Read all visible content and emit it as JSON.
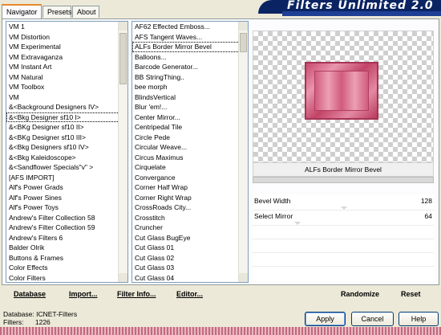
{
  "window": {
    "title": "Filters Unlimited 2.0",
    "colors": {
      "accent": "#0a2463",
      "preview_pink": "#d9668a",
      "tab_highlight": "#e68b2c"
    }
  },
  "tabs": [
    {
      "label": "Navigator",
      "active": true
    },
    {
      "label": "Presets",
      "active": false
    },
    {
      "label": "About",
      "active": false
    }
  ],
  "categories": [
    "VM 1",
    "VM Distortion",
    "VM Experimental",
    "VM Extravaganza",
    "VM Instant Art",
    "VM Natural",
    "VM Toolbox",
    "VM",
    "&<Background Designers IV>",
    "&<Bkg Designer sf10 I>",
    "&<BKg Designer sf10 II>",
    "&<BKg Designer sf10 III>",
    "&<Bkg Designers sf10 IV>",
    "&<Bkg Kaleidoscope>",
    "&<Sandflower Specials\"v\" >",
    "[AFS IMPORT]",
    "Alf's Power Grads",
    "Alf's Power Sines",
    "Alf's Power Toys",
    "Andrew's Filter Collection 58",
    "Andrew's Filter Collection 59",
    "Andrew's Filters 6",
    "Balder Olrik",
    "Buttons & Frames",
    "Color Effects",
    "Color Filters"
  ],
  "selected_category": "&<Bkg Designer sf10 I>",
  "filters": [
    "AF62 Effected Emboss...",
    "AFS Tangent Waves...",
    "ALFs Border Mirror Bevel",
    "Balloons...",
    "Barcode Generator...",
    "BB StringThing..",
    "bee morph",
    "BlindsVertical",
    "Blur 'em!...",
    "Center Mirror...",
    "Centripedal Tile",
    "Circle Pede",
    "Circular Weave...",
    "Circus Maximus",
    "Cirquelate",
    "Convergance",
    "Corner Half Wrap",
    "Corner Right Wrap",
    "CrossRoads City...",
    "Crosstitch",
    "Cruncher",
    "Cut Glass  BugEye",
    "Cut Glass 01",
    "Cut Glass 02",
    "Cut Glass 03",
    "Cut Glass 04"
  ],
  "selected_filter": "ALFs Border Mirror Bevel",
  "preview": {
    "filter_name": "ALFs Border Mirror Bevel"
  },
  "controls": [
    {
      "label": "Bevel Width",
      "value": "128"
    },
    {
      "label": "Select Mirror",
      "value": "64"
    }
  ],
  "left_buttons": {
    "database": "Database",
    "import": "Import...",
    "filter_info": "Filter Info...",
    "editor": "Editor..."
  },
  "right_buttons": {
    "randomize": "Randomize",
    "reset": "Reset"
  },
  "status": {
    "database_label": "Database:",
    "database_value": "ICNET-Filters",
    "filters_label": "Filters:",
    "filters_value": "1226"
  },
  "dialog_buttons": {
    "apply": "Apply",
    "cancel": "Cancel",
    "help": "Help"
  }
}
